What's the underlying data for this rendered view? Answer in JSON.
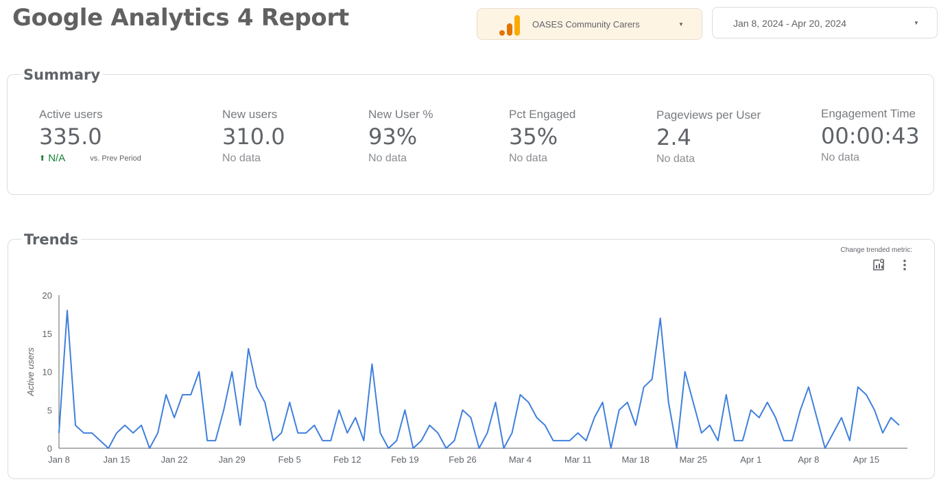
{
  "header": {
    "title": "Google Analytics 4 Report",
    "property": "OASES Community Carers",
    "date_range": "Jan 8, 2024 - Apr 20, 2024"
  },
  "summary": {
    "title": "Summary",
    "metrics": [
      {
        "label": "Active users",
        "value": "335.0",
        "change": "N/A",
        "comparison": "vs. Prev Period"
      },
      {
        "label": "New users",
        "value": "310.0",
        "sub": "No data"
      },
      {
        "label": "New User %",
        "value": "93%",
        "sub": "No data"
      },
      {
        "label": "Pct Engaged",
        "value": "35%",
        "sub": "No data"
      },
      {
        "label": "Pageviews per User",
        "value": "2.4",
        "sub": "No data"
      },
      {
        "label": "Engagement Time",
        "value": "00:00:43",
        "sub": "No data"
      }
    ]
  },
  "trends": {
    "title": "Trends",
    "change_metric_label": "Change trended metric:"
  },
  "icons": {
    "analytics_logo": "google-analytics-logo",
    "dropdown": "chevron-down-icon",
    "chart_settings": "chart-settings-icon",
    "more": "more-vert-icon"
  },
  "colors": {
    "line": "#3f7fdc",
    "positive": "#188038",
    "ga_orange": "#f9ab00",
    "ga_dark_orange": "#e37400"
  },
  "chart_data": {
    "type": "line",
    "title": "",
    "xlabel": "",
    "ylabel": "Active users",
    "ylim": [
      0,
      20
    ],
    "yticks": [
      0,
      5,
      10,
      15,
      20
    ],
    "xticks": [
      "Jan 8",
      "Jan 15",
      "Jan 22",
      "Jan 29",
      "Feb 5",
      "Feb 12",
      "Feb 19",
      "Feb 26",
      "Mar 4",
      "Mar 11",
      "Mar 18",
      "Mar 25",
      "Apr 1",
      "Apr 8",
      "Apr 15"
    ],
    "x_start": "2024-01-08",
    "x_end": "2024-04-20",
    "grid": false,
    "series": [
      {
        "values": [
          2,
          18,
          3,
          2,
          2,
          1,
          0,
          2,
          3,
          2,
          3,
          0,
          2,
          7,
          4,
          7,
          7,
          10,
          1,
          1,
          5,
          10,
          3,
          13,
          8,
          6,
          1,
          2,
          6,
          2,
          2,
          3,
          1,
          1,
          5,
          2,
          4,
          1,
          11,
          2,
          0,
          1,
          5,
          0,
          1,
          3,
          2,
          0,
          1,
          5,
          4,
          0,
          2,
          6,
          0,
          2,
          7,
          6,
          4,
          3,
          1,
          1,
          1,
          2,
          1,
          4,
          6,
          0,
          5,
          6,
          3,
          8,
          9,
          17,
          6,
          0,
          10,
          6,
          2,
          3,
          1,
          7,
          1,
          1,
          5,
          4,
          6,
          4,
          1,
          1,
          5,
          8,
          4,
          0,
          2,
          4,
          1,
          8,
          7,
          5,
          2,
          4,
          3
        ]
      }
    ]
  }
}
